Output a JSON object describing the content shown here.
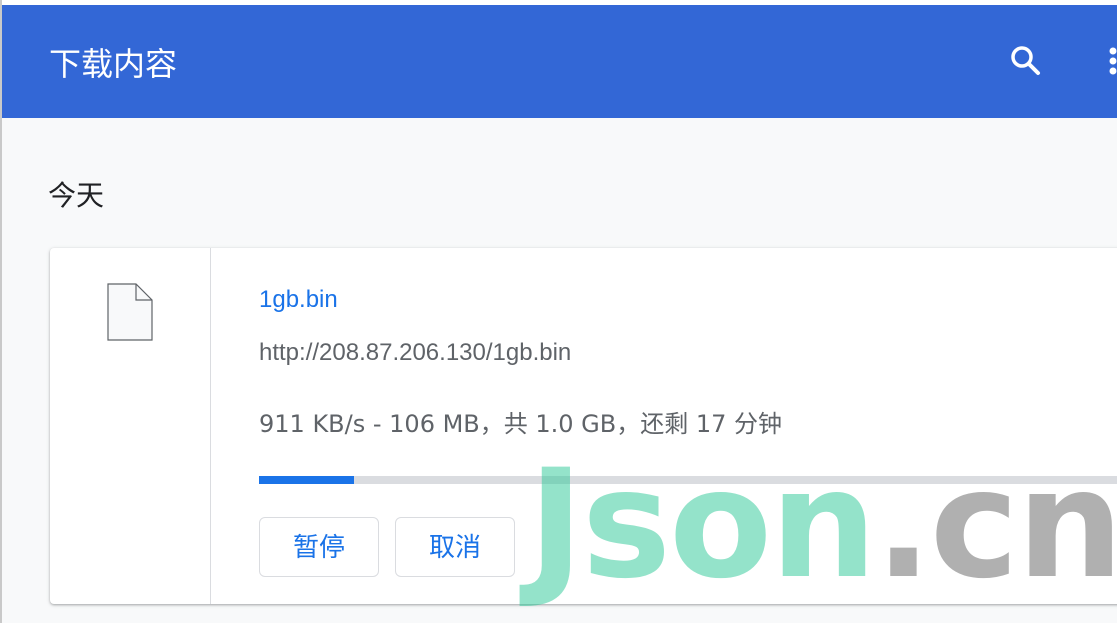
{
  "toolbar": {
    "title": "下载内容",
    "search_icon": "search-icon",
    "more_icon": "more-vert-icon",
    "color": "#3367d6"
  },
  "section": {
    "heading": "今天"
  },
  "download": {
    "file_icon": "file-icon",
    "file_name": "1gb.bin",
    "url": "http://208.87.206.130/1gb.bin",
    "status": "911 KB/s - 106 MB，共 1.0 GB，还剩 17 分钟",
    "progress_fraction": 0.106,
    "pause_label": "暂停",
    "cancel_label": "取消",
    "accent_color": "#1a73e8"
  },
  "watermark": {
    "main": "Json",
    "tld": ".cn"
  }
}
